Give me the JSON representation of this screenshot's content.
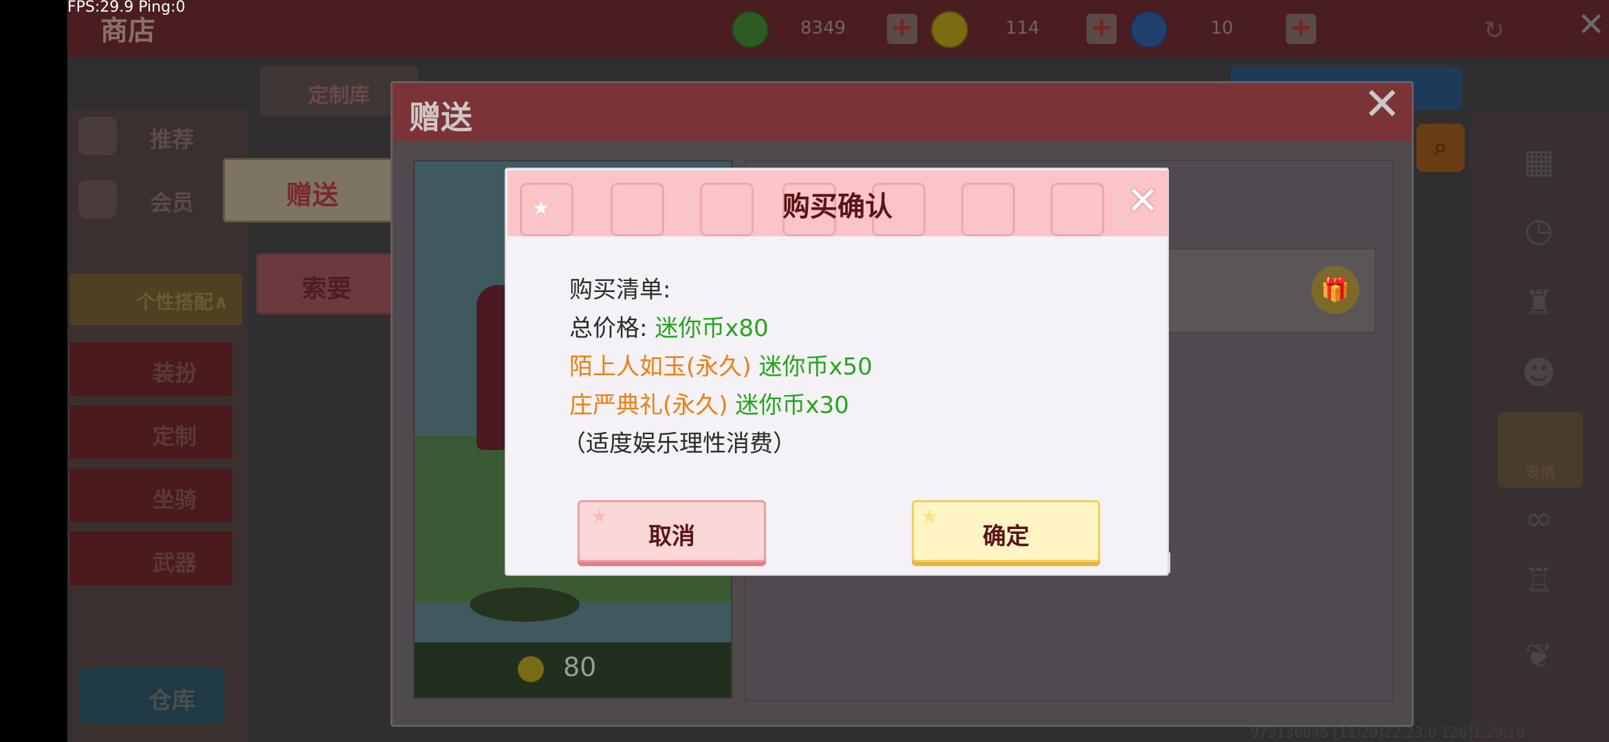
{
  "debug": {
    "fps_label": "FPS:29.9  Ping:0"
  },
  "shop": {
    "title": "商店",
    "currencies": [
      {
        "icon": "green-coin-icon",
        "value": "8349"
      },
      {
        "icon": "gold-coin-icon",
        "value": "114"
      },
      {
        "icon": "blue-coin-icon",
        "value": "10"
      }
    ],
    "tab_custom_lib": "定制库",
    "nav": {
      "recommend": "推荐",
      "member": "会员",
      "personal": "个性搭配∧",
      "dress": "装扮",
      "custom": "定制",
      "mount": "坐骑",
      "weapon": "武器",
      "warehouse": "仓库"
    },
    "right_emoji": "表情",
    "bottom_info": "973136845   [11/29]22:23:0   126]1.29.10"
  },
  "gift": {
    "title": "赠送",
    "tab_give": "赠送",
    "tab_ask": "索要",
    "preview_price": "80"
  },
  "confirm": {
    "title": "购买确认",
    "list_label": "购买清单:",
    "total_label": "总价格:",
    "total_value": "迷你币x80",
    "item1_name": "陌上人如玉(永久)",
    "item1_price": "迷你币x50",
    "item2_name": "庄严典礼(永久)",
    "item2_price": "迷你币x30",
    "notice": "（适度娱乐理性消费）",
    "cancel": "取消",
    "ok": "确定"
  },
  "colors": {
    "green_text": "#23a51c",
    "orange_text": "#f07d0c",
    "header_pink": "#fbc4c8"
  }
}
